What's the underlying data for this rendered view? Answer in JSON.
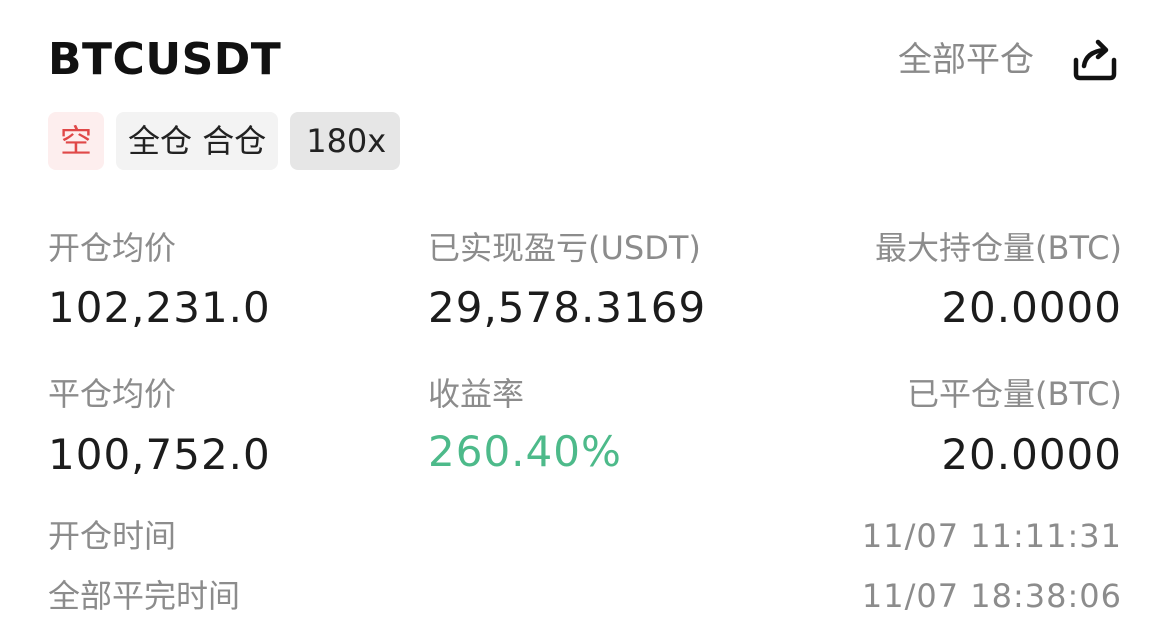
{
  "header": {
    "symbol": "BTCUSDT",
    "close_all_label": "全部平仓",
    "share_icon": "share-icon"
  },
  "tags": {
    "side": "空",
    "margin_mode": "全仓 合仓",
    "leverage": "180x"
  },
  "stats": {
    "open_avg_price_label": "开仓均价",
    "open_avg_price": "102,231.0",
    "realized_pnl_label": "已实现盈亏(USDT)",
    "realized_pnl": "29,578.3169",
    "max_position_label": "最大持仓量(BTC)",
    "max_position": "20.0000",
    "close_avg_price_label": "平仓均价",
    "close_avg_price": "100,752.0",
    "roi_label": "收益率",
    "roi": "260.40%",
    "closed_qty_label": "已平仓量(BTC)",
    "closed_qty": "20.0000"
  },
  "times": {
    "open_time_label": "开仓时间",
    "open_time": "11/07 11:11:31",
    "full_close_time_label": "全部平完时间",
    "full_close_time": "11/07 18:38:06"
  },
  "colors": {
    "short_red": "#e04848",
    "profit_green": "#4dba8a",
    "muted_gray": "#8c8c8c"
  }
}
